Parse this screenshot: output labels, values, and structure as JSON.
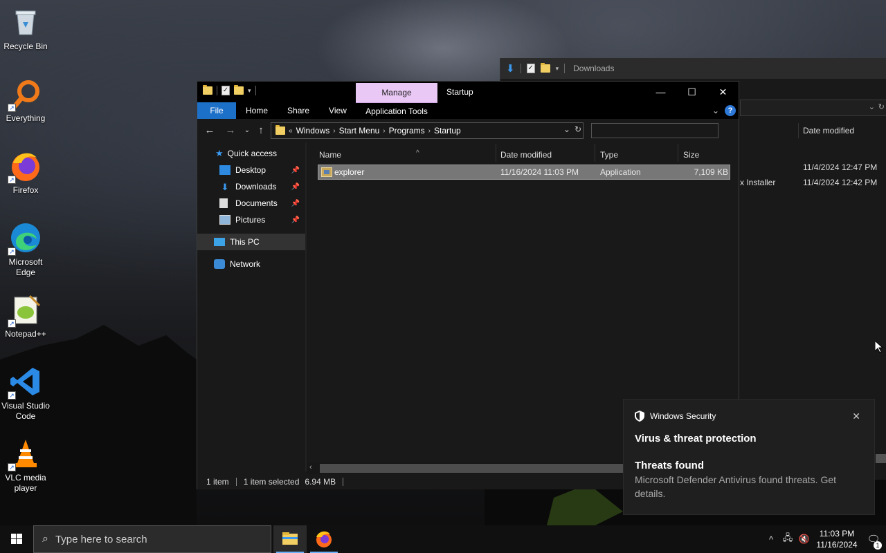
{
  "desktop": {
    "icons": [
      {
        "label": "Recycle Bin",
        "icon": "recycle-bin-icon"
      },
      {
        "label": "Everything",
        "icon": "everything-search-icon"
      },
      {
        "label": "Firefox",
        "icon": "firefox-icon"
      },
      {
        "label": "Microsoft Edge",
        "icon": "edge-icon"
      },
      {
        "label": "Notepad++",
        "icon": "notepadpp-icon"
      },
      {
        "label": "Visual Studio Code",
        "icon": "vscode-icon"
      },
      {
        "label": "VLC media player",
        "icon": "vlc-icon"
      }
    ]
  },
  "background_window": {
    "title": "Downloads",
    "column_date": "Date modified",
    "rows": [
      {
        "name": "",
        "date": "11/4/2024 12:47 PM"
      },
      {
        "name": "x Installer",
        "date": "11/4/2024 12:42 PM"
      }
    ]
  },
  "explorer": {
    "title": "Startup",
    "manage_tab": "Manage",
    "ribbon_tabs": [
      "File",
      "Home",
      "Share",
      "View"
    ],
    "app_tools_tab": "Application Tools",
    "breadcrumb": {
      "prefix": "«",
      "items": [
        "Windows",
        "Start Menu",
        "Programs",
        "Startup"
      ]
    },
    "search_placeholder": "",
    "nav": {
      "quick_access": "Quick access",
      "desktop": "Desktop",
      "downloads": "Downloads",
      "documents": "Documents",
      "pictures": "Pictures",
      "this_pc": "This PC",
      "network": "Network"
    },
    "columns": {
      "name": "Name",
      "date": "Date modified",
      "type": "Type",
      "size": "Size"
    },
    "files": [
      {
        "name": "explorer",
        "date": "11/16/2024 11:03 PM",
        "type": "Application",
        "size": "7,109 KB"
      }
    ],
    "status": {
      "count": "1 item",
      "selected": "1 item selected",
      "size": "6.94 MB"
    }
  },
  "toast": {
    "app": "Windows Security",
    "heading": "Virus & threat protection",
    "subheading": "Threats found",
    "body": "Microsoft Defender Antivirus found threats. Get details."
  },
  "taskbar": {
    "search_placeholder": "Type here to search",
    "time": "11:03 PM",
    "date": "11/16/2024",
    "notification_count": "1"
  },
  "colors": {
    "accent": "#1d70c8",
    "manage_tab": "#e9c8f5",
    "selected_row": "#777777"
  }
}
